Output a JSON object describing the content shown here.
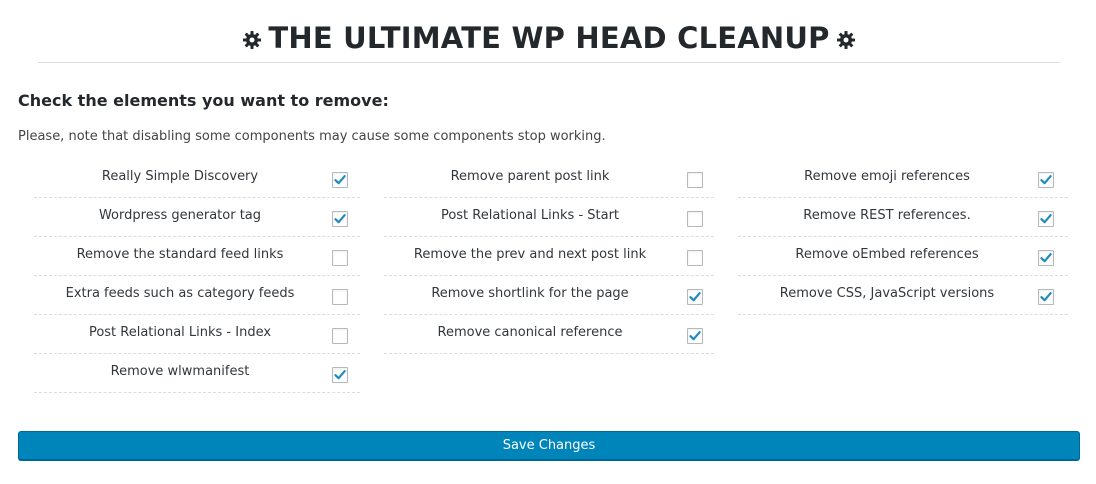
{
  "header": {
    "title": "THE ULTIMATE WP HEAD CLEANUP",
    "left_icon": "gear-icon",
    "right_icon": "gear-icon"
  },
  "form": {
    "heading": "Check the elements you want to remove:",
    "note": "Please, note that disabling some components may cause some components stop working.",
    "columns": [
      [
        {
          "label": "Really Simple Discovery",
          "checked": true
        },
        {
          "label": "Wordpress generator tag",
          "checked": true
        },
        {
          "label": "Remove the standard feed links",
          "checked": false
        },
        {
          "label": "Extra feeds such as category feeds",
          "checked": false
        },
        {
          "label": "Post Relational Links - Index",
          "checked": false
        },
        {
          "label": "Remove wlwmanifest",
          "checked": true
        }
      ],
      [
        {
          "label": "Remove parent post link",
          "checked": false
        },
        {
          "label": "Post Relational Links - Start",
          "checked": false
        },
        {
          "label": "Remove the prev and next post link",
          "checked": false
        },
        {
          "label": "Remove shortlink for the page",
          "checked": true
        },
        {
          "label": "Remove canonical reference",
          "checked": true
        }
      ],
      [
        {
          "label": "Remove emoji references",
          "checked": true
        },
        {
          "label": "Remove REST references.",
          "checked": true
        },
        {
          "label": "Remove oEmbed references",
          "checked": true
        },
        {
          "label": "Remove CSS, JavaScript versions",
          "checked": true
        }
      ]
    ],
    "save_label": "Save Changes"
  },
  "colors": {
    "primary_button": "#0085ba",
    "checkmark": "#1e8cbe",
    "text": "#23282d"
  }
}
